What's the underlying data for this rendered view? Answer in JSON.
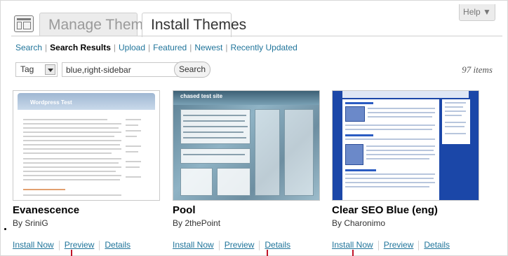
{
  "header": {
    "tabs": [
      {
        "label": "Manage Themes",
        "active": false
      },
      {
        "label": "Install Themes",
        "active": true
      }
    ],
    "help_label": "Help ▼"
  },
  "subnav": {
    "items": [
      {
        "label": "Search",
        "current": false
      },
      {
        "label": "Search Results",
        "current": true
      },
      {
        "label": "Upload",
        "current": false
      },
      {
        "label": "Featured",
        "current": false
      },
      {
        "label": "Newest",
        "current": false
      },
      {
        "label": "Recently Updated",
        "current": false
      }
    ]
  },
  "search": {
    "type_value": "Tag",
    "query_value": "blue,right-sidebar",
    "button_label": "Search",
    "count_label": "97 items"
  },
  "themes": [
    {
      "name": "Evanescence",
      "author": "By SriniG",
      "preview_heading": "Wordpress Test",
      "actions": {
        "install": "Install Now",
        "preview": "Preview",
        "details": "Details"
      }
    },
    {
      "name": "Pool",
      "author": "By 2thePoint",
      "preview_heading": "chased test site",
      "actions": {
        "install": "Install Now",
        "preview": "Preview",
        "details": "Details"
      }
    },
    {
      "name": "Clear SEO Blue (eng)",
      "author": "By Charonimo",
      "actions": {
        "install": "Install Now",
        "preview": "Preview",
        "details": "Details"
      }
    }
  ],
  "colors": {
    "link": "#21759b",
    "marker": "#c0152a",
    "clear_seo_blue": "#1b47a8"
  }
}
